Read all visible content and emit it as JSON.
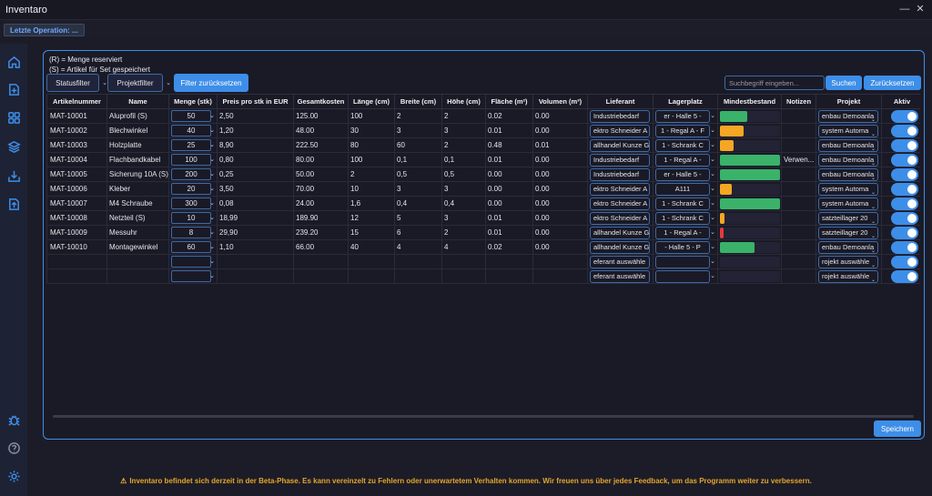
{
  "app": {
    "title": "Inventaro",
    "minimize": "—",
    "close": "✕"
  },
  "status": {
    "last_op": "Letzte Operation: ..."
  },
  "sidebar": {
    "items": [
      "home-icon",
      "add-item-icon",
      "grid-icon",
      "layers-icon",
      "import-icon",
      "export-icon"
    ],
    "bottom": [
      "bug-icon",
      "help-icon",
      "settings-icon"
    ]
  },
  "legend": {
    "reserved": "(R) = Menge reserviert",
    "set": "(S) = Artikel für Set gespeichert"
  },
  "toolbar": {
    "status_filter": "Statusfilter",
    "project_filter": "Projektfilter",
    "reset_filter": "Filter zurücksetzen",
    "search_placeholder": "Suchbegriff eingeben...",
    "search": "Suchen",
    "reset": "Zurücksetzen",
    "save": "Speichern"
  },
  "columns": [
    "Artikelnummer",
    "Name",
    "Menge (stk)",
    "Preis pro stk in EUR",
    "Gesamtkosten",
    "Länge (cm)",
    "Breite (cm)",
    "Höhe (cm)",
    "Fläche (m²)",
    "Volumen (m³)",
    "Lieferant",
    "Lagerplatz",
    "Mindestbestand",
    "Notizen",
    "Projekt",
    "Aktiv"
  ],
  "rows": [
    {
      "id": "MAT-10001",
      "name": "Aluprofil (S)",
      "qty": "50",
      "price": "2,50",
      "total": "125.00",
      "l": "100",
      "w": "2",
      "h": "2",
      "area": "0.02",
      "vol": "0.00",
      "supplier": "Industriebedarf",
      "loc": "er - Halle 5 -",
      "stock": 0.45,
      "stock_color": "#3ab26a",
      "notes": "",
      "project": "enbau Demoanla"
    },
    {
      "id": "MAT-10002",
      "name": "Blechwinkel",
      "qty": "40",
      "price": "1,20",
      "total": "48.00",
      "l": "30",
      "w": "3",
      "h": "3",
      "area": "0.01",
      "vol": "0.00",
      "supplier": "ektro Schneider A",
      "loc": "1 - Regal A - F",
      "stock": 0.4,
      "stock_color": "#f5a623",
      "notes": "",
      "project": "system Automa"
    },
    {
      "id": "MAT-10003",
      "name": "Holzplatte",
      "qty": "25",
      "price": "8,90",
      "total": "222.50",
      "l": "80",
      "w": "60",
      "h": "2",
      "area": "0.48",
      "vol": "0.01",
      "supplier": "allhandel Kunze G",
      "loc": "1 - Schrank C",
      "stock": 0.23,
      "stock_color": "#f5a623",
      "notes": "",
      "project": "enbau Demoanla"
    },
    {
      "id": "MAT-10004",
      "name": "Flachbandkabel",
      "qty": "100",
      "price": "0,80",
      "total": "80.00",
      "l": "100",
      "w": "0,1",
      "h": "0,1",
      "area": "0.01",
      "vol": "0.00",
      "supplier": "Industriebedarf",
      "loc": "1 - Regal A -",
      "stock": 1.0,
      "stock_color": "#3ab26a",
      "notes": "Verwen...",
      "project": "enbau Demoanla"
    },
    {
      "id": "MAT-10005",
      "name": "Sicherung 10A (S)",
      "qty": "200",
      "price": "0,25",
      "total": "50.00",
      "l": "2",
      "w": "0,5",
      "h": "0,5",
      "area": "0.00",
      "vol": "0.00",
      "supplier": "Industriebedarf",
      "loc": "er - Halle 5 -",
      "stock": 1.0,
      "stock_color": "#3ab26a",
      "notes": "",
      "project": "enbau Demoanla"
    },
    {
      "id": "MAT-10006",
      "name": "Kleber",
      "qty": "20",
      "price": "3,50",
      "total": "70.00",
      "l": "10",
      "w": "3",
      "h": "3",
      "area": "0.00",
      "vol": "0.00",
      "supplier": "ektro Schneider A",
      "loc": "A111",
      "stock": 0.2,
      "stock_color": "#f5a623",
      "notes": "",
      "project": "system Automa"
    },
    {
      "id": "MAT-10007",
      "name": "M4 Schraube",
      "qty": "300",
      "price": "0,08",
      "total": "24.00",
      "l": "1,6",
      "w": "0,4",
      "h": "0,4",
      "area": "0.00",
      "vol": "0.00",
      "supplier": "ektro Schneider A",
      "loc": "1 - Schrank C",
      "stock": 1.0,
      "stock_color": "#3ab26a",
      "notes": "",
      "project": "system Automa"
    },
    {
      "id": "MAT-10008",
      "name": "Netzteil (S)",
      "qty": "10",
      "price": "18,99",
      "total": "189.90",
      "l": "12",
      "w": "5",
      "h": "3",
      "area": "0.01",
      "vol": "0.00",
      "supplier": "ektro Schneider A",
      "loc": "1 - Schrank C",
      "stock": 0.08,
      "stock_color": "#f5a623",
      "notes": "",
      "project": "satzteillager 20"
    },
    {
      "id": "MAT-10009",
      "name": "Messuhr",
      "qty": "8",
      "price": "29,90",
      "total": "239.20",
      "l": "15",
      "w": "6",
      "h": "2",
      "area": "0.01",
      "vol": "0.00",
      "supplier": "allhandel Kunze G",
      "loc": "1 - Regal A -",
      "stock": 0.06,
      "stock_color": "#e03c3c",
      "notes": "",
      "project": "satzteillager 20"
    },
    {
      "id": "MAT-10010",
      "name": "Montagewinkel",
      "qty": "60",
      "price": "1,10",
      "total": "66.00",
      "l": "40",
      "w": "4",
      "h": "4",
      "area": "0.02",
      "vol": "0.00",
      "supplier": "allhandel Kunze G",
      "loc": "- Halle 5 - P",
      "stock": 0.58,
      "stock_color": "#3ab26a",
      "notes": "",
      "project": "enbau Demoanla"
    },
    {
      "id": "",
      "name": "",
      "qty": "",
      "price": "",
      "total": "",
      "l": "",
      "w": "",
      "h": "",
      "area": "",
      "vol": "",
      "supplier": "eferant auswähle",
      "loc": "",
      "stock": 0,
      "stock_color": "",
      "notes": "",
      "project": "rojekt auswähle"
    },
    {
      "id": "",
      "name": "",
      "qty": "",
      "price": "",
      "total": "",
      "l": "",
      "w": "",
      "h": "",
      "area": "",
      "vol": "",
      "supplier": "eferant auswähle",
      "loc": "",
      "stock": 0,
      "stock_color": "",
      "notes": "",
      "project": "rojekt auswähle"
    }
  ],
  "footer": {
    "text": "Inventaro befindet sich derzeit in der Beta-Phase. Es kann vereinzelt zu Fehlern oder unerwartetem Verhalten kommen. Wir freuen uns über jedes Feedback, um das Programm weiter zu verbessern."
  },
  "colors": {
    "accent": "#3d8ee8",
    "ok": "#3ab26a",
    "warn": "#f5a623",
    "critical": "#e03c3c"
  }
}
